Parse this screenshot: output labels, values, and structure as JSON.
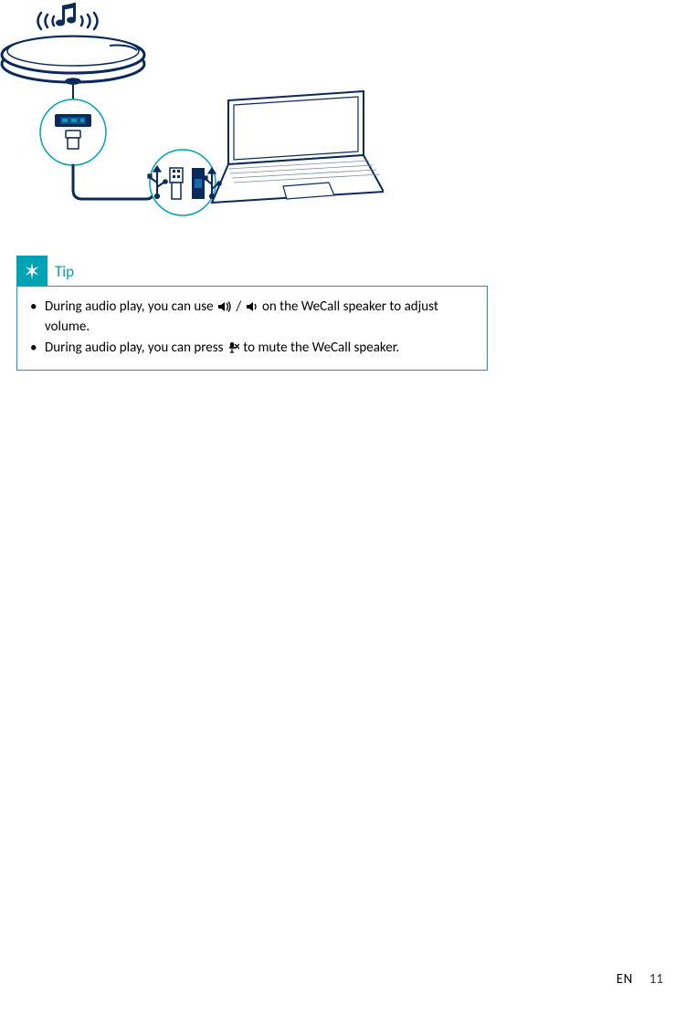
{
  "footer": {
    "lang": "EN",
    "page_number": "11"
  },
  "tip": {
    "label": "Tip",
    "items": [
      {
        "pre": "During audio play, you can use ",
        "sep": " / ",
        "post": " on the WeCall speaker to adjust volume.",
        "icon1": "volume-up-icon",
        "icon2": "volume-down-icon"
      },
      {
        "pre": "During audio play, you can press ",
        "post": " to mute the WeCall speaker.",
        "icon1": "mic-mute-icon"
      }
    ]
  },
  "diagram": {
    "description": "WeCall speaker connected via USB cable to a laptop; sound-wave/music icon above speaker; USB port call-out on speaker; USB plug and port call-out near laptop.",
    "icons": {
      "music_waves": "music-note-with-signal-waves-icon",
      "usb_port": "usb-port-icon",
      "usb_plug": "usb-plug-icon",
      "usb_trident": "usb-symbol-icon",
      "laptop": "laptop-icon"
    }
  }
}
